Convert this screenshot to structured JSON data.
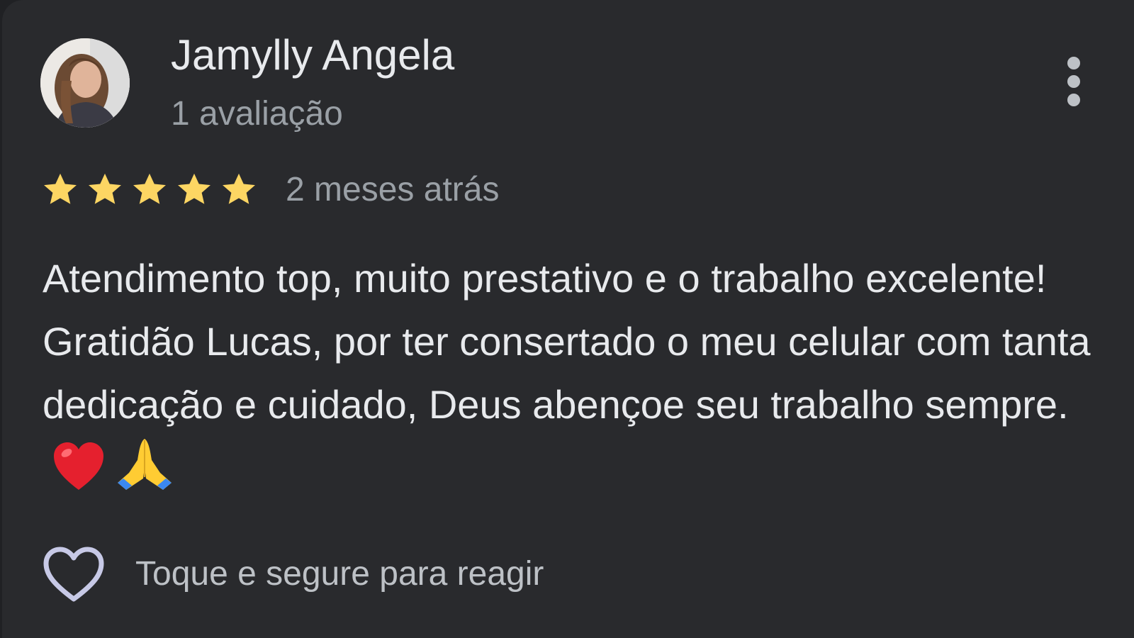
{
  "review": {
    "author_name": "Jamylly Angela",
    "author_review_count": "1 avaliação",
    "rating": 5,
    "rating_max": 5,
    "star_color": "#fdd663",
    "time_ago": "2 meses atrás",
    "text": "Atendimento top, muito prestativo e o trabalho excelente! Gratidão Lucas, por ter consertado o meu celular com tanta dedicação e cuidado, Deus abençoe seu trabalho sempre.",
    "emojis": [
      "red-heart-emoji",
      "folded-hands-emoji"
    ]
  },
  "actions": {
    "react_label": "Toque e segure para reagir",
    "react_icon": "heart-outline-icon",
    "more_icon": "more-vert-icon"
  },
  "colors": {
    "background": "#292a2d",
    "primary_text": "#e8eaed",
    "secondary_text": "#9aa0a6"
  }
}
